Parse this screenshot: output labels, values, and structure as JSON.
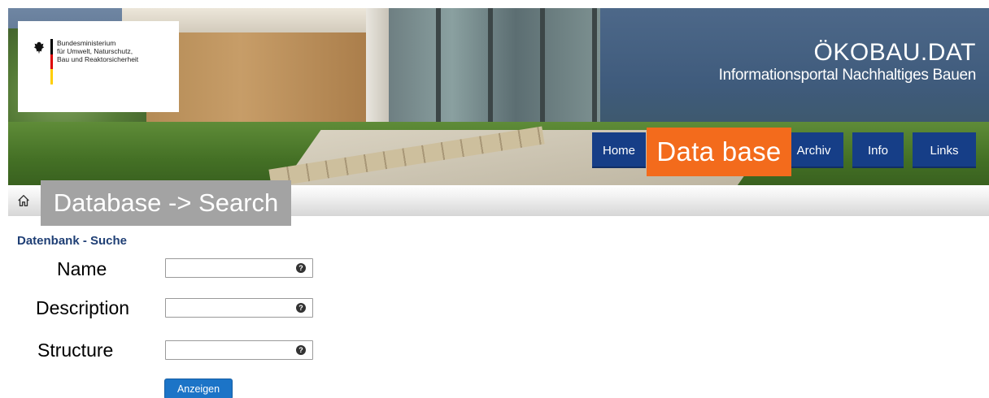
{
  "header": {
    "ministry_name": [
      "Bundesministerium",
      "für Umwelt, Naturschutz,",
      "Bau und Reaktorsicherheit"
    ],
    "site_title": "ÖKOBAU.DAT",
    "site_subtitle": "Informationsportal Nachhaltiges Bauen",
    "colors": {
      "nav_bg": "#163e87",
      "highlight": "#f36b1c"
    }
  },
  "nav": {
    "items": [
      {
        "label": "Home"
      },
      {
        "label": "Data base"
      },
      {
        "label": "Archiv"
      },
      {
        "label": "Info"
      },
      {
        "label": "Links"
      }
    ]
  },
  "breadcrumb": {
    "icon": "home-icon",
    "label": "Database -> Search"
  },
  "search": {
    "heading": "Datenbank - Suche",
    "fields": [
      {
        "label": "Name",
        "value": "",
        "help_icon": "question-icon"
      },
      {
        "label": "Description",
        "value": "",
        "help_icon": "question-icon"
      },
      {
        "label": "Structure",
        "value": "",
        "help_icon": "question-icon"
      }
    ],
    "submit_label": "Anzeigen"
  }
}
